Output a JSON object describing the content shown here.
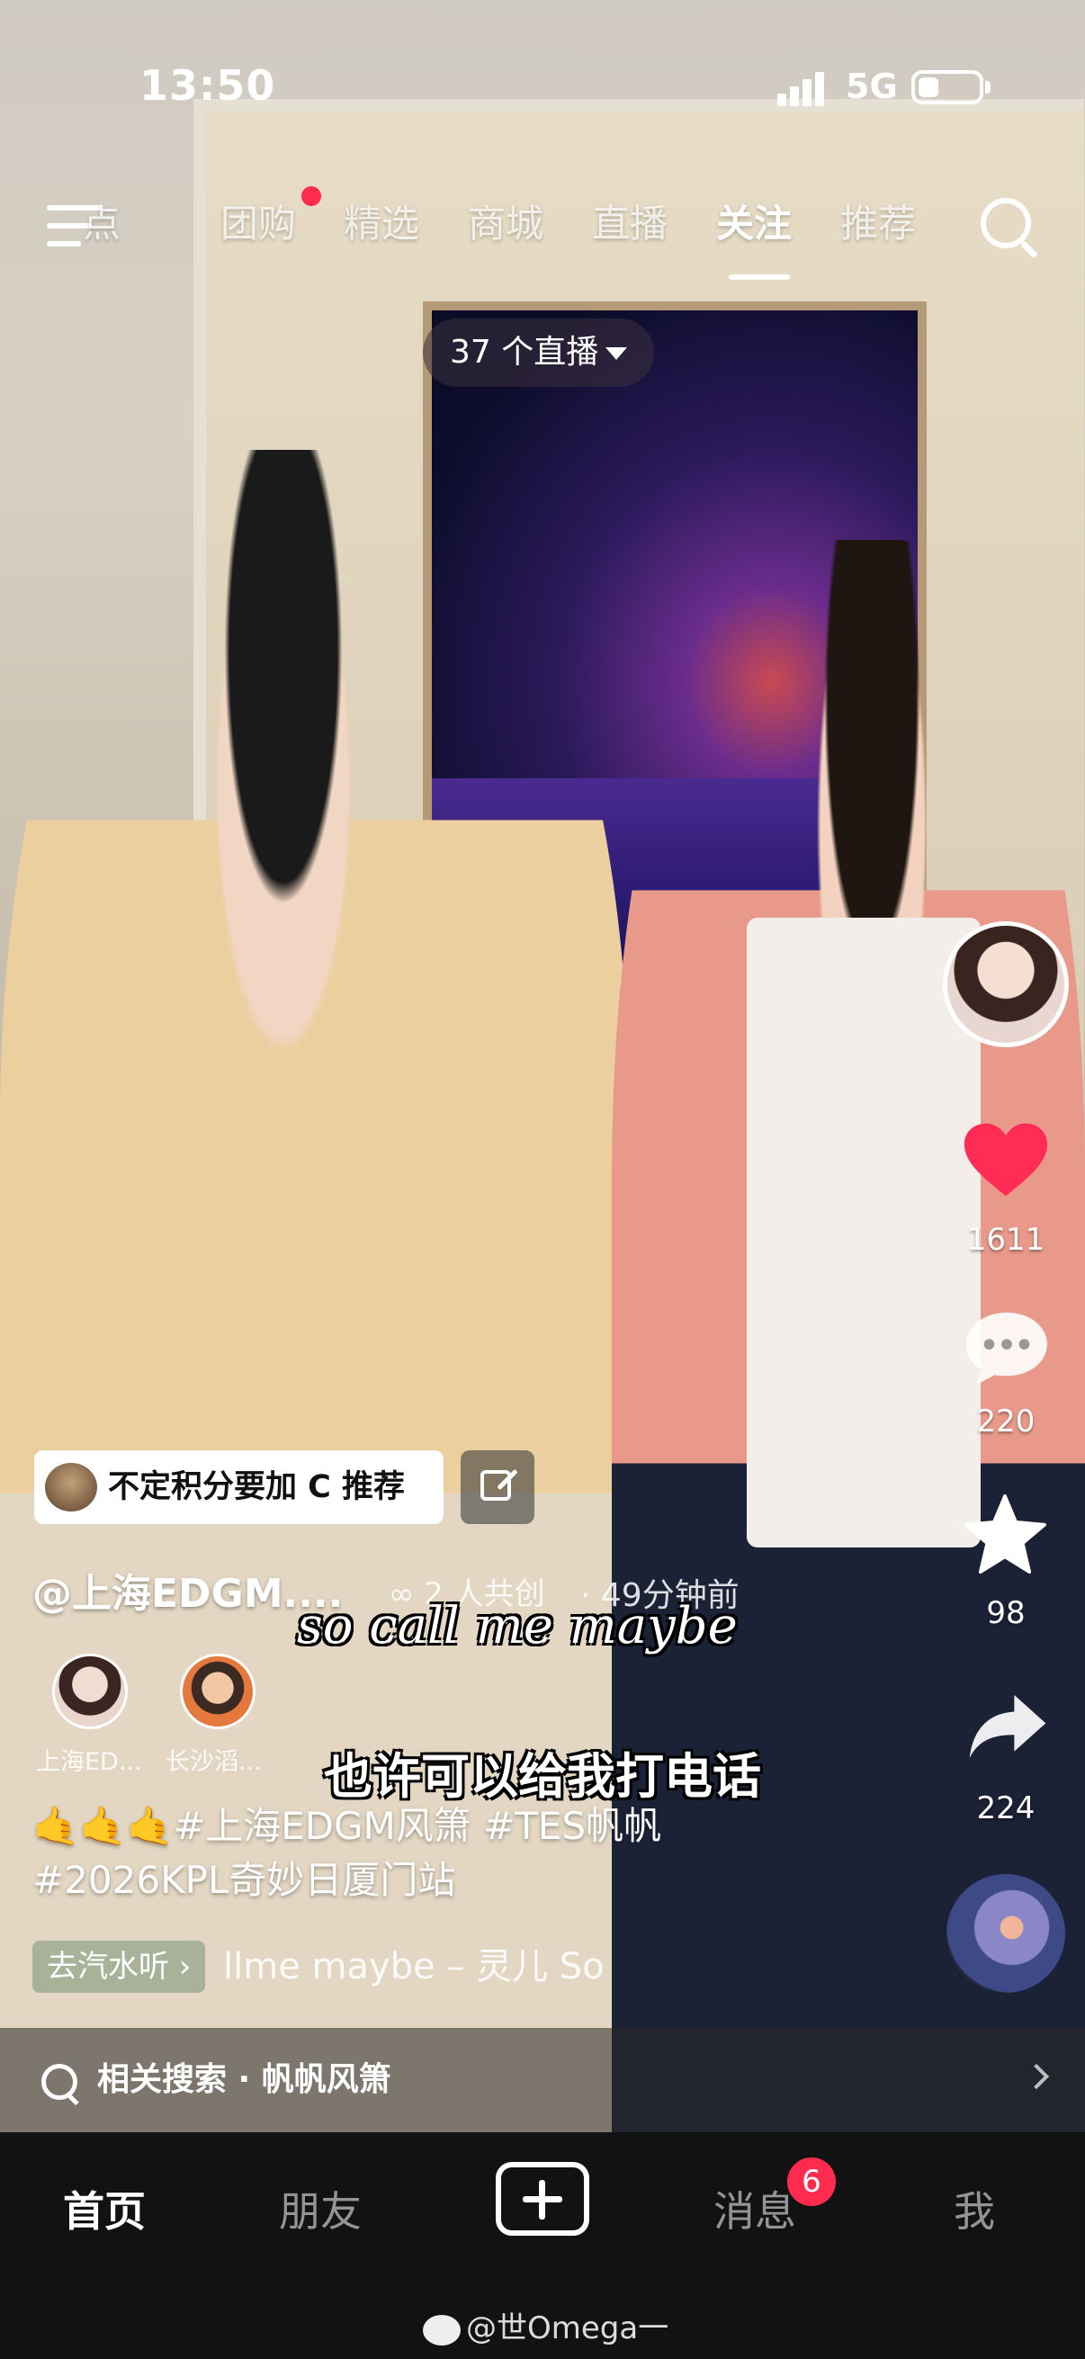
{
  "status_bar": {
    "time": "13:50",
    "network": "5G",
    "battery_level": 0.35
  },
  "top_nav": {
    "tabs": [
      {
        "label": "点"
      },
      {
        "label": "团购"
      },
      {
        "label": "精选"
      },
      {
        "label": "商城"
      },
      {
        "label": "直播"
      },
      {
        "label": "关注"
      },
      {
        "label": "推荐"
      }
    ],
    "active_tab": "关注",
    "icons": [
      "menu-icon",
      "search-icon"
    ]
  },
  "live_pill": {
    "label": "37 个直播"
  },
  "right_rail": {
    "likes": "1611",
    "comments": "220",
    "favorites": "98",
    "shares": "224",
    "like_color": "#ff2d55"
  },
  "video_info": {
    "recommend_chip": "不定积分要加 C 推荐",
    "author": "@上海EDGM....",
    "cocreate": "2 人共创",
    "time_ago": "· 49分钟前",
    "co_creators": [
      {
        "name": "上海ED..."
      },
      {
        "name": "长沙滔..."
      }
    ],
    "caption_line1": "🤙🤙🤙#上海EDGM风箫 #TES帆帆",
    "caption_line2": "#2026KPL奇妙日厦门站",
    "music_chip": "去汽水听 ›",
    "music_title": "llme maybe – 灵儿  So"
  },
  "subtitles": {
    "english": "so call me maybe",
    "chinese": "也许可以给我打电话"
  },
  "related_search": {
    "label": "相关搜索 · 帆帆风箫"
  },
  "bottom_nav": {
    "items": [
      {
        "label": "首页"
      },
      {
        "label": "朋友"
      },
      {
        "label": "消息"
      },
      {
        "label": "我"
      }
    ],
    "active": "首页",
    "message_badge": "6"
  },
  "watermark": {
    "text": "@世Omega一"
  }
}
